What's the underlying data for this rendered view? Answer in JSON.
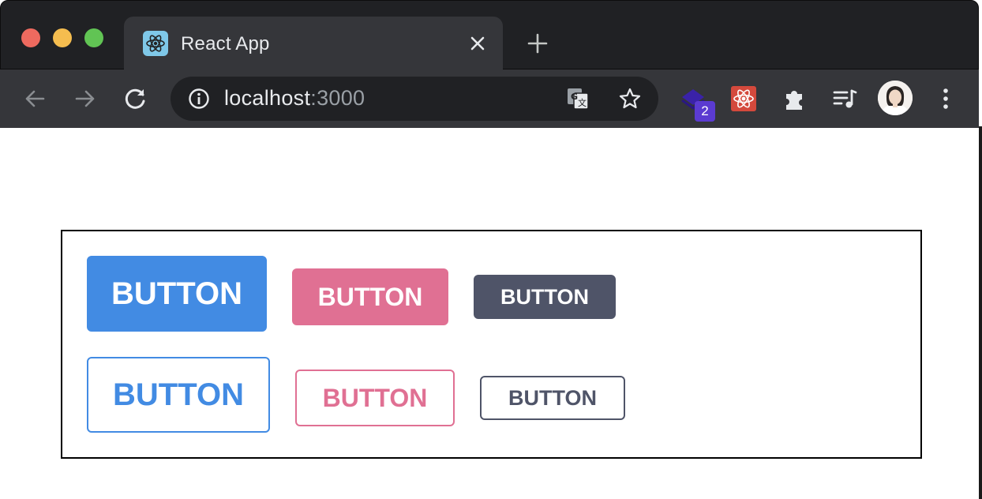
{
  "browser": {
    "tab": {
      "title": "React App",
      "favicon": "react-icon"
    },
    "omnibox": {
      "host": "localhost",
      "port": ":3000"
    },
    "extensions": {
      "badge_count": "2"
    }
  },
  "page": {
    "rows": [
      {
        "buttons": [
          {
            "label": "BUTTON",
            "color": "#428be3",
            "variant": "filled",
            "size": "large"
          },
          {
            "label": "BUTTON",
            "color": "#e07093",
            "variant": "filled",
            "size": "medium"
          },
          {
            "label": "BUTTON",
            "color": "#4f5468",
            "variant": "filled",
            "size": "small"
          }
        ]
      },
      {
        "buttons": [
          {
            "label": "BUTTON",
            "color": "#428be3",
            "variant": "outline",
            "size": "large"
          },
          {
            "label": "BUTTON",
            "color": "#e07093",
            "variant": "outline",
            "size": "medium"
          },
          {
            "label": "BUTTON",
            "color": "#4f5468",
            "variant": "outline",
            "size": "small"
          }
        ]
      }
    ]
  },
  "colors": {
    "blue": "#428be3",
    "pink": "#e07093",
    "gray": "#4f5468",
    "chrome_dark": "#202124",
    "chrome_toolbar": "#35363a"
  }
}
